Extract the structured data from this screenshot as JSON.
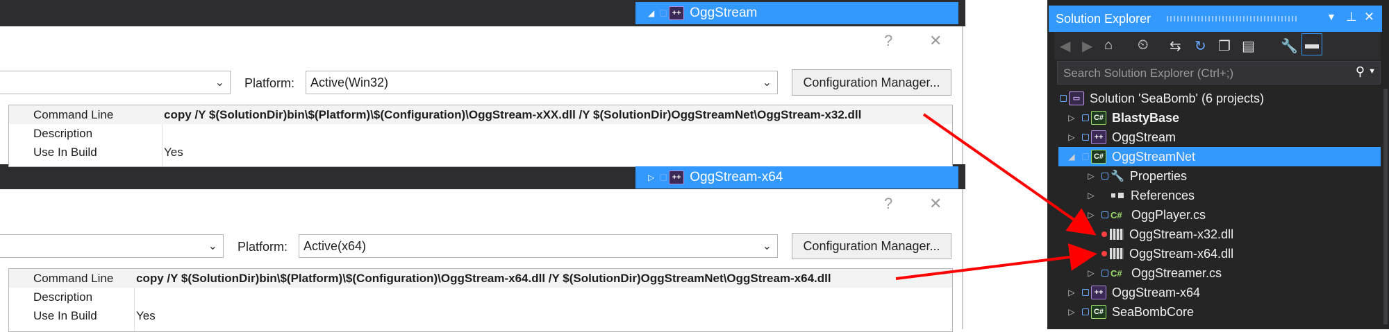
{
  "top_node": {
    "label": "OggStream"
  },
  "mid_node": {
    "label": "OggStream-x64"
  },
  "dialog_controls": {
    "help": "?",
    "close": "✕"
  },
  "dialog1": {
    "platform_label": "Platform:",
    "platform_value": "Active(Win32)",
    "config_manager": "Configuration Manager...",
    "rows": [
      {
        "name": "Command Line",
        "value": "copy /Y $(SolutionDir)bin\\$(Platform)\\$(Configuration)\\OggStream-xXX.dll /Y $(SolutionDir)OggStreamNet\\OggStream-x32.dll"
      },
      {
        "name": "Description",
        "value": ""
      },
      {
        "name": "Use In Build",
        "value": "Yes"
      }
    ]
  },
  "dialog2": {
    "platform_label": "Platform:",
    "platform_value": "Active(x64)",
    "config_manager": "Configuration Manager...",
    "rows": [
      {
        "name": "Command Line",
        "value": "copy /Y $(SolutionDir)bin\\$(Platform)\\$(Configuration)\\OggStream-x64.dll /Y $(SolutionDir)OggStreamNet\\OggStream-x64.dll"
      },
      {
        "name": "Description",
        "value": ""
      },
      {
        "name": "Use In Build",
        "value": "Yes"
      }
    ]
  },
  "solution_explorer": {
    "title": "Solution Explorer",
    "search_placeholder": "Search Solution Explorer (Ctrl+;)",
    "items": [
      {
        "label": "Solution 'SeaBomb' (6 projects)"
      },
      {
        "label": "BlastyBase"
      },
      {
        "label": "OggStream"
      },
      {
        "label": "OggStreamNet"
      },
      {
        "label": "Properties"
      },
      {
        "label": "References"
      },
      {
        "label": "OggPlayer.cs"
      },
      {
        "label": "OggStream-x32.dll"
      },
      {
        "label": "OggStream-x64.dll"
      },
      {
        "label": "OggStreamer.cs"
      },
      {
        "label": "OggStream-x64"
      },
      {
        "label": "SeaBombCore"
      }
    ]
  },
  "colors": {
    "accent": "#3399ff",
    "arrow": "#ff0000",
    "dark_bg": "#252526"
  }
}
